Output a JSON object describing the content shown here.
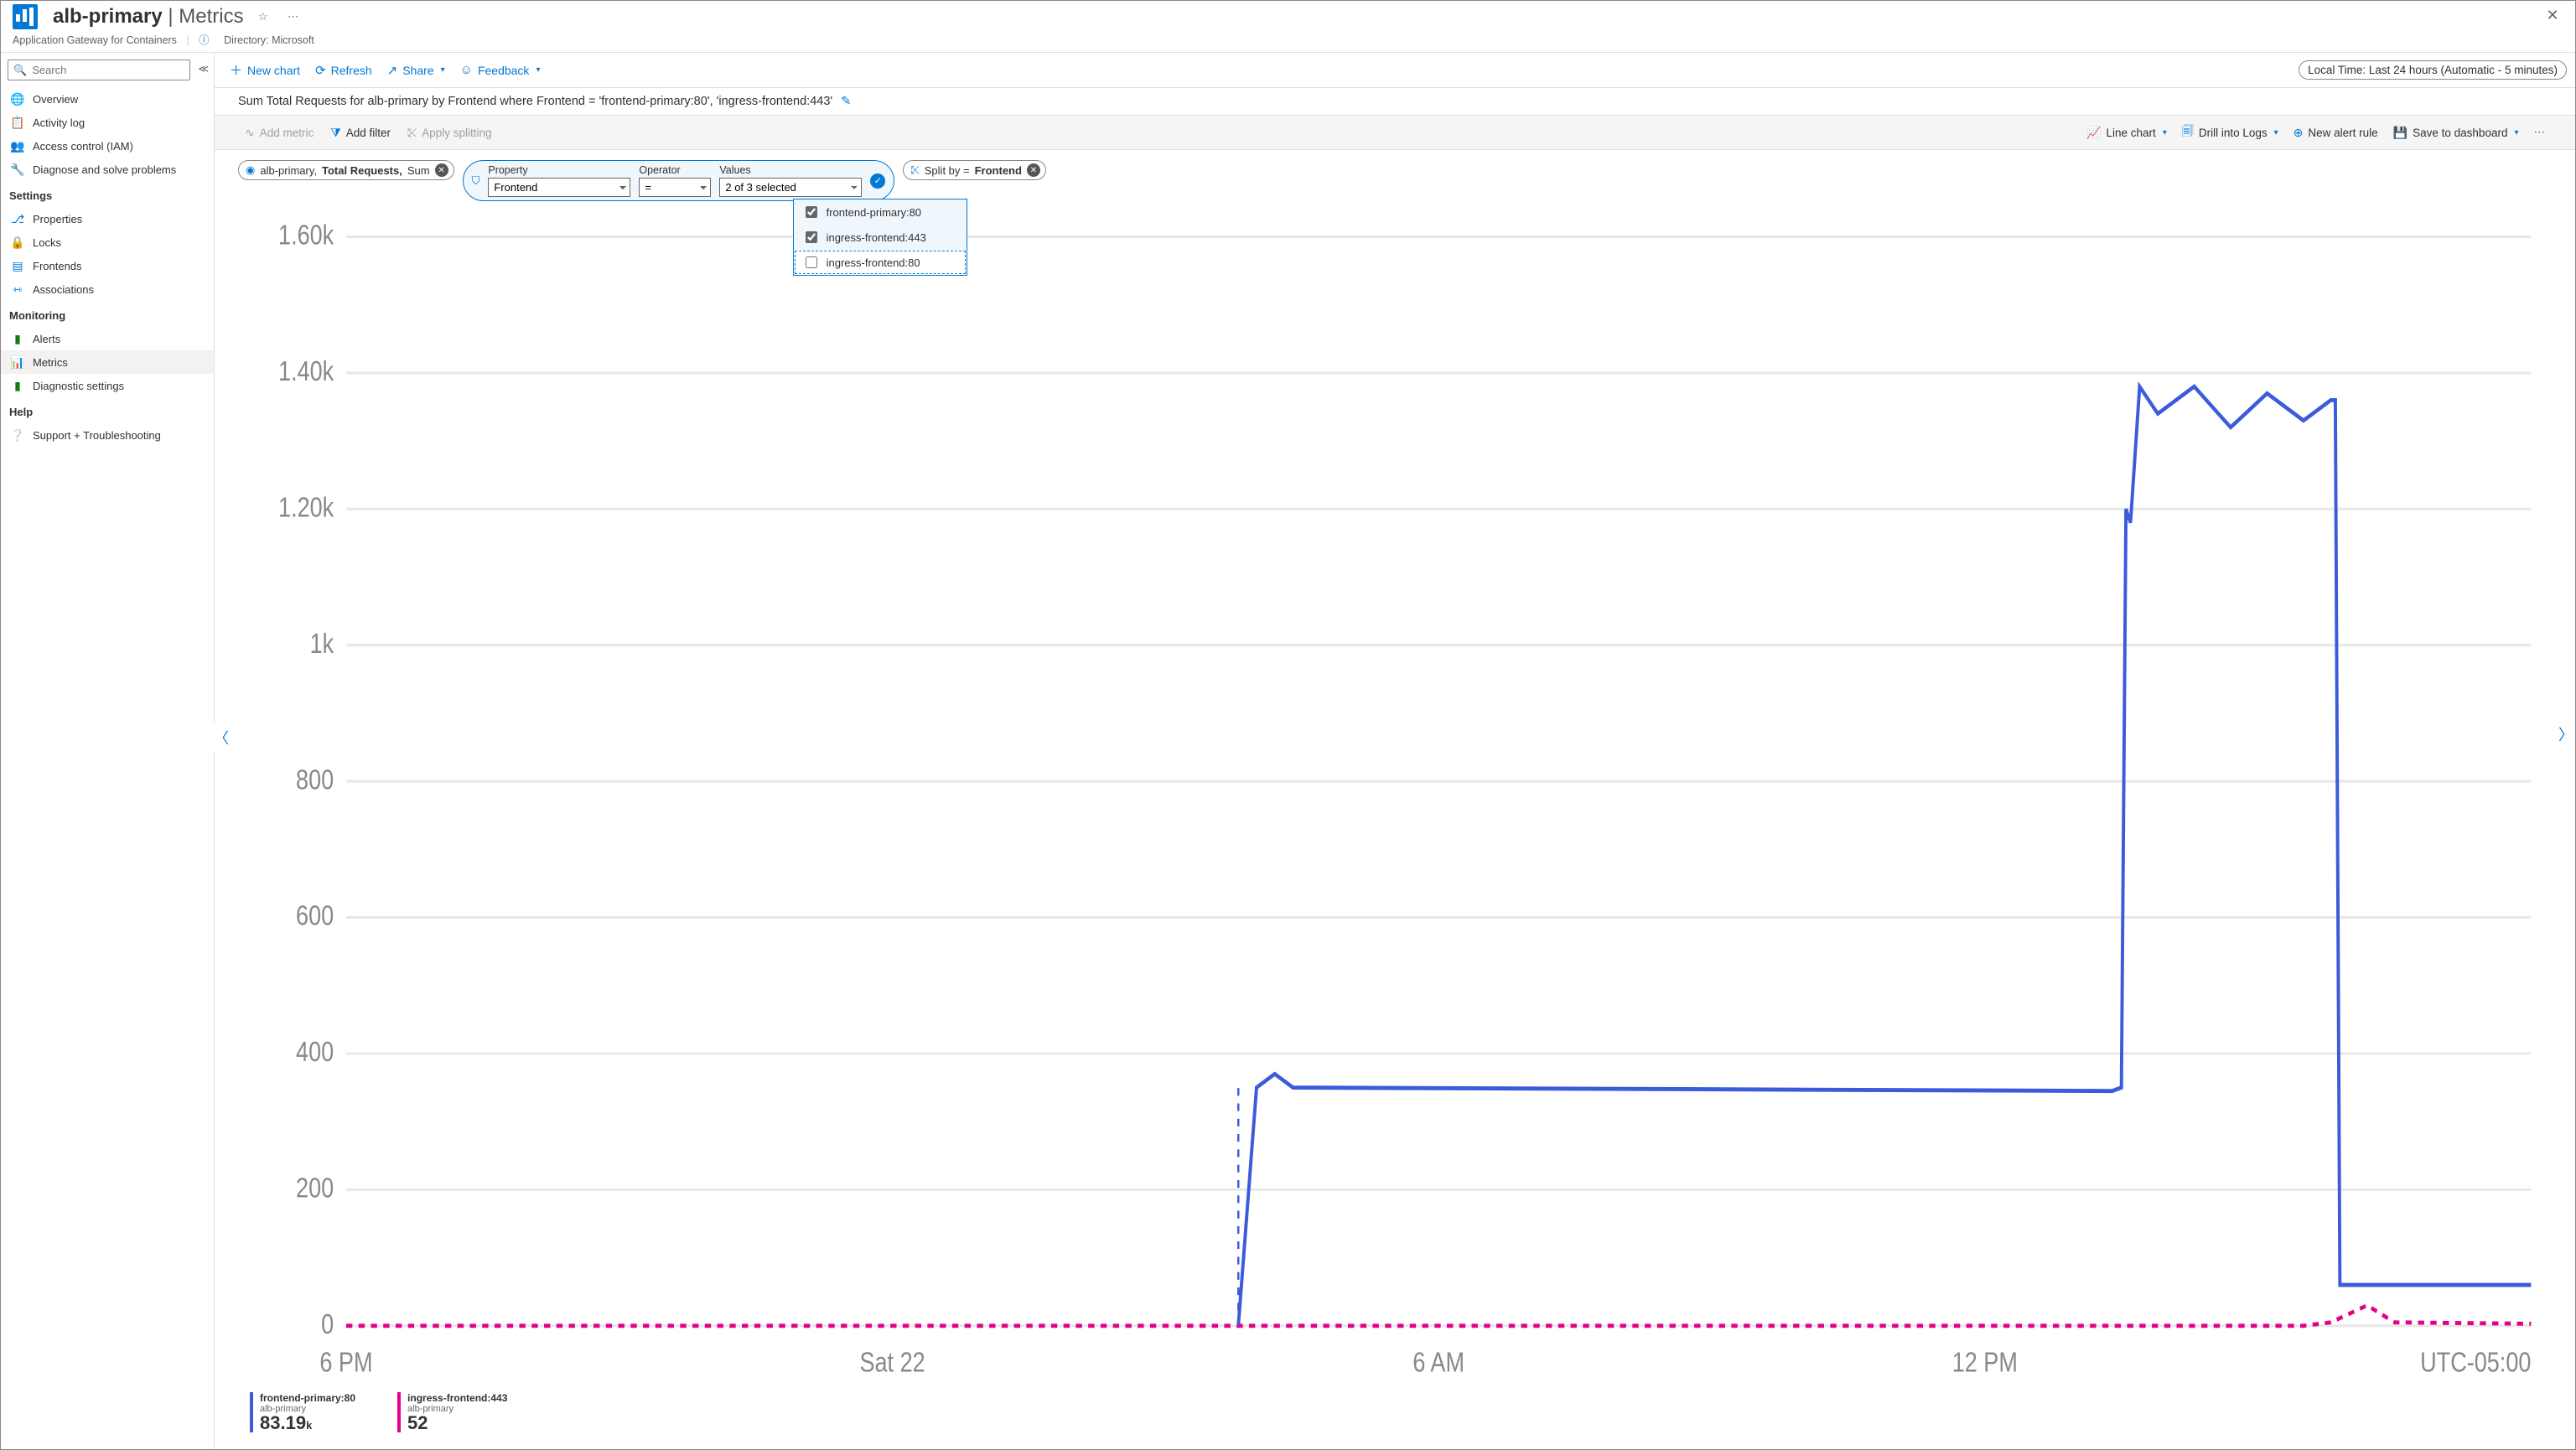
{
  "header": {
    "resource_name": "alb-primary",
    "page": "Metrics",
    "subtitle": "Application Gateway for Containers",
    "directory_label": "Directory: Microsoft"
  },
  "sidebar": {
    "search_placeholder": "Search",
    "items": [
      {
        "icon": "globe",
        "label": "Overview"
      },
      {
        "icon": "log",
        "label": "Activity log"
      },
      {
        "icon": "people",
        "label": "Access control (IAM)"
      },
      {
        "icon": "wrench",
        "label": "Diagnose and solve problems"
      }
    ],
    "settings_header": "Settings",
    "settings": [
      {
        "icon": "props",
        "label": "Properties"
      },
      {
        "icon": "lock",
        "label": "Locks"
      },
      {
        "icon": "front",
        "label": "Frontends"
      },
      {
        "icon": "assoc",
        "label": "Associations"
      }
    ],
    "monitoring_header": "Monitoring",
    "monitoring": [
      {
        "icon": "alerts",
        "label": "Alerts"
      },
      {
        "icon": "metrics",
        "label": "Metrics",
        "active": true
      },
      {
        "icon": "diag",
        "label": "Diagnostic settings"
      }
    ],
    "help_header": "Help",
    "help": [
      {
        "icon": "help",
        "label": "Support + Troubleshooting"
      }
    ]
  },
  "cmdbar": {
    "new_chart": "New chart",
    "refresh": "Refresh",
    "share": "Share",
    "feedback": "Feedback",
    "time": "Local Time: Last 24 hours (Automatic - 5 minutes)"
  },
  "chart_title": "Sum Total Requests for alb-primary by Frontend where Frontend = 'frontend-primary:80', 'ingress-frontend:443'",
  "toolbar": {
    "add_metric": "Add metric",
    "add_filter": "Add filter",
    "apply_splitting": "Apply splitting",
    "line_chart": "Line chart",
    "drill_logs": "Drill into Logs",
    "new_alert": "New alert rule",
    "save": "Save to dashboard"
  },
  "metric_pill": {
    "resource": "alb-primary,",
    "metric": "Total Requests,",
    "agg": "Sum"
  },
  "filter": {
    "property_label": "Property",
    "property_value": "Frontend",
    "operator_label": "Operator",
    "operator_value": "=",
    "values_label": "Values",
    "values_display": "2 of 3 selected",
    "options": [
      {
        "label": "frontend-primary:80",
        "checked": true
      },
      {
        "label": "ingress-frontend:443",
        "checked": true
      },
      {
        "label": "ingress-frontend:80",
        "checked": false
      }
    ]
  },
  "split_pill": {
    "prefix": "Split by =",
    "value": "Frontend"
  },
  "legend": {
    "series": [
      {
        "name": "frontend-primary:80",
        "resource": "alb-primary",
        "value": "83.19",
        "unit": "k",
        "color": "blue"
      },
      {
        "name": "ingress-frontend:443",
        "resource": "alb-primary",
        "value": "52",
        "unit": "",
        "color": "magenta"
      }
    ]
  },
  "chart_data": {
    "type": "line",
    "title": "Sum Total Requests for alb-primary by Frontend",
    "ylabel": "",
    "xlabel": "",
    "ylim": [
      0,
      1600
    ],
    "y_ticks": [
      0,
      200,
      400,
      600,
      800,
      1000,
      1200,
      1400,
      1600
    ],
    "y_tick_labels": [
      "0",
      "200",
      "400",
      "600",
      "800",
      "1k",
      "1.20k",
      "1.40k",
      "1.60k"
    ],
    "x_ticks": [
      0,
      6,
      12,
      18,
      24
    ],
    "x_tick_labels": [
      "6 PM",
      "Sat 22",
      "6 AM",
      "12 PM",
      ""
    ],
    "tz_label": "UTC-05:00",
    "x_range_hours": 24,
    "series": [
      {
        "name": "frontend-primary:80",
        "color": "#3b5bdb",
        "points": [
          [
            0,
            null
          ],
          [
            9.7,
            null
          ],
          [
            9.8,
            0
          ],
          [
            10.0,
            350
          ],
          [
            10.2,
            370
          ],
          [
            10.4,
            350
          ],
          [
            19.4,
            345
          ],
          [
            19.5,
            350
          ],
          [
            19.55,
            1200
          ],
          [
            19.6,
            1180
          ],
          [
            19.7,
            1380
          ],
          [
            19.9,
            1340
          ],
          [
            20.3,
            1380
          ],
          [
            20.7,
            1320
          ],
          [
            21.1,
            1370
          ],
          [
            21.5,
            1330
          ],
          [
            21.8,
            1360
          ],
          [
            21.85,
            1360
          ],
          [
            21.9,
            60
          ],
          [
            24,
            60
          ]
        ]
      },
      {
        "name": "ingress-frontend:443",
        "color": "#e3008c",
        "points": [
          [
            0,
            0
          ],
          [
            21.5,
            0
          ],
          [
            21.8,
            5
          ],
          [
            22.2,
            30
          ],
          [
            22.5,
            5
          ],
          [
            24,
            3
          ]
        ]
      }
    ]
  }
}
